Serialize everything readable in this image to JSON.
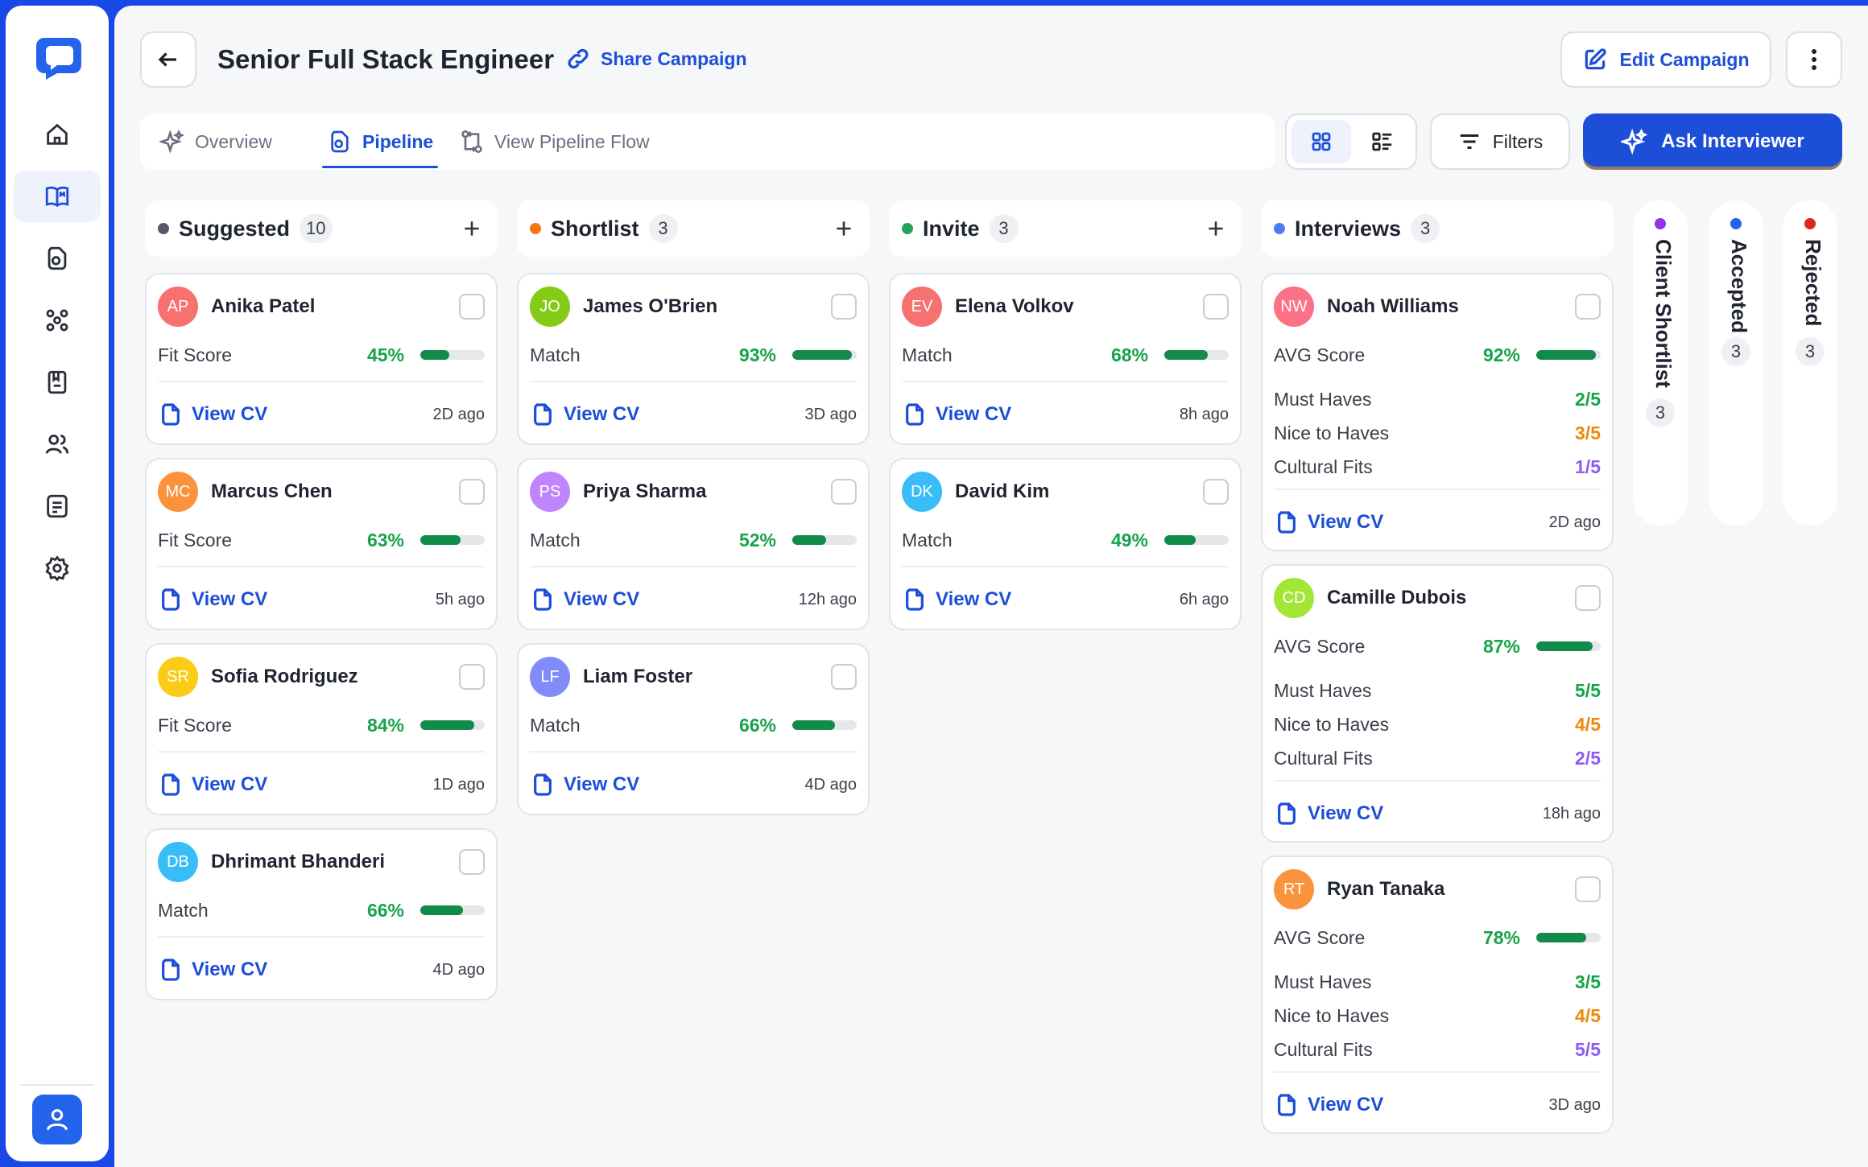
{
  "header": {
    "title": "Senior Full Stack Engineer",
    "share_label": "Share Campaign",
    "edit_label": "Edit Campaign"
  },
  "tabs": [
    {
      "label": "Overview",
      "icon": "sparkle-icon"
    },
    {
      "label": "Pipeline",
      "icon": "pipeline-icon",
      "active": true
    },
    {
      "label": "View Pipeline Flow",
      "icon": "flow-icon"
    }
  ],
  "toolbar": {
    "filters_label": "Filters",
    "ask_label": "Ask Interviewer",
    "view_mode": "grid"
  },
  "colors": {
    "brand": "#1D4ED8",
    "score_green": "#16A34A",
    "score_orange": "#EA8A0C",
    "score_purple": "#8B5CF6"
  },
  "columns": [
    {
      "title": "Suggested",
      "count": "10",
      "dot_color": "#555B66",
      "cards": [
        {
          "initials": "AP",
          "name": "Anika Patel",
          "avatar_color": "#F87171",
          "score_label": "Fit Score",
          "score": "45%",
          "score_value": 45,
          "cv_label": "View CV",
          "time": "2D ago"
        },
        {
          "initials": "MC",
          "name": "Marcus Chen",
          "avatar_color": "#FB923C",
          "score_label": "Fit Score",
          "score": "63%",
          "score_value": 63,
          "cv_label": "View CV",
          "time": "5h ago"
        },
        {
          "initials": "SR",
          "name": "Sofia Rodriguez",
          "avatar_color": "#FACC15",
          "score_label": "Fit Score",
          "score": "84%",
          "score_value": 84,
          "cv_label": "View CV",
          "time": "1D ago"
        },
        {
          "initials": "DB",
          "name": "Dhrimant Bhanderi",
          "avatar_color": "#38BDF8",
          "score_label": "Match",
          "score": "66%",
          "score_value": 66,
          "cv_label": "View CV",
          "time": "4D ago"
        }
      ]
    },
    {
      "title": "Shortlist",
      "count": "3",
      "dot_color": "#F97316",
      "cards": [
        {
          "initials": "JO",
          "name": "James O'Brien",
          "avatar_color": "#84CC16",
          "score_label": "Match",
          "score": "93%",
          "score_value": 93,
          "cv_label": "View CV",
          "time": "3D ago"
        },
        {
          "initials": "PS",
          "name": "Priya Sharma",
          "avatar_color": "#C084FC",
          "score_label": "Match",
          "score": "52%",
          "score_value": 52,
          "cv_label": "View CV",
          "time": "12h ago"
        },
        {
          "initials": "LF",
          "name": "Liam Foster",
          "avatar_color": "#818CF8",
          "score_label": "Match",
          "score": "66%",
          "score_value": 66,
          "cv_label": "View CV",
          "time": "4D ago"
        }
      ]
    },
    {
      "title": "Invite",
      "count": "3",
      "dot_color": "#22A35A",
      "cards": [
        {
          "initials": "EV",
          "name": "Elena Volkov",
          "avatar_color": "#F87171",
          "score_label": "Match",
          "score": "68%",
          "score_value": 68,
          "cv_label": "View CV",
          "time": "8h ago"
        },
        {
          "initials": "DK",
          "name": "David Kim",
          "avatar_color": "#38BDF8",
          "score_label": "Match",
          "score": "49%",
          "score_value": 49,
          "cv_label": "View CV",
          "time": "6h ago"
        }
      ]
    },
    {
      "title": "Interviews",
      "count": "3",
      "dot_color": "#4F7BF0",
      "cards": [
        {
          "initials": "NW",
          "name": "Noah Williams",
          "avatar_color": "#FB7185",
          "score_label": "AVG Score",
          "score": "92%",
          "score_value": 92,
          "must_label": "Must Haves",
          "must": "2/5",
          "nice_label": "Nice to Haves",
          "nice": "3/5",
          "cultural_label": "Cultural Fits",
          "cultural": "1/5",
          "cv_label": "View CV",
          "time": "2D ago"
        },
        {
          "initials": "CD",
          "name": "Camille Dubois",
          "avatar_color": "#A3E635",
          "score_label": "AVG Score",
          "score": "87%",
          "score_value": 87,
          "must_label": "Must Haves",
          "must": "5/5",
          "nice_label": "Nice to Haves",
          "nice": "4/5",
          "cultural_label": "Cultural Fits",
          "cultural": "2/5",
          "cv_label": "View CV",
          "time": "18h ago"
        },
        {
          "initials": "RT",
          "name": "Ryan Tanaka",
          "avatar_color": "#FB923C",
          "score_label": "AVG Score",
          "score": "78%",
          "score_value": 78,
          "must_label": "Must Haves",
          "must": "3/5",
          "nice_label": "Nice to Haves",
          "nice": "4/5",
          "cultural_label": "Cultural Fits",
          "cultural": "5/5",
          "cv_label": "View CV",
          "time": "3D ago"
        }
      ]
    }
  ],
  "collapsed_columns": [
    {
      "title": "Client Shortlist",
      "count": "3",
      "dot_color": "#9333EA"
    },
    {
      "title": "Accepted",
      "count": "3",
      "dot_color": "#2563EB"
    },
    {
      "title": "Rejected",
      "count": "3",
      "dot_color": "#DC2626"
    }
  ],
  "sidebar": {
    "items": [
      {
        "icon": "home-icon"
      },
      {
        "icon": "book-icon",
        "active": true
      },
      {
        "icon": "document-icon"
      },
      {
        "icon": "team-icon"
      },
      {
        "icon": "notebook-icon"
      },
      {
        "icon": "users-icon"
      },
      {
        "icon": "notes-icon"
      },
      {
        "icon": "settings-icon"
      }
    ],
    "profile_icon": "user-icon"
  }
}
